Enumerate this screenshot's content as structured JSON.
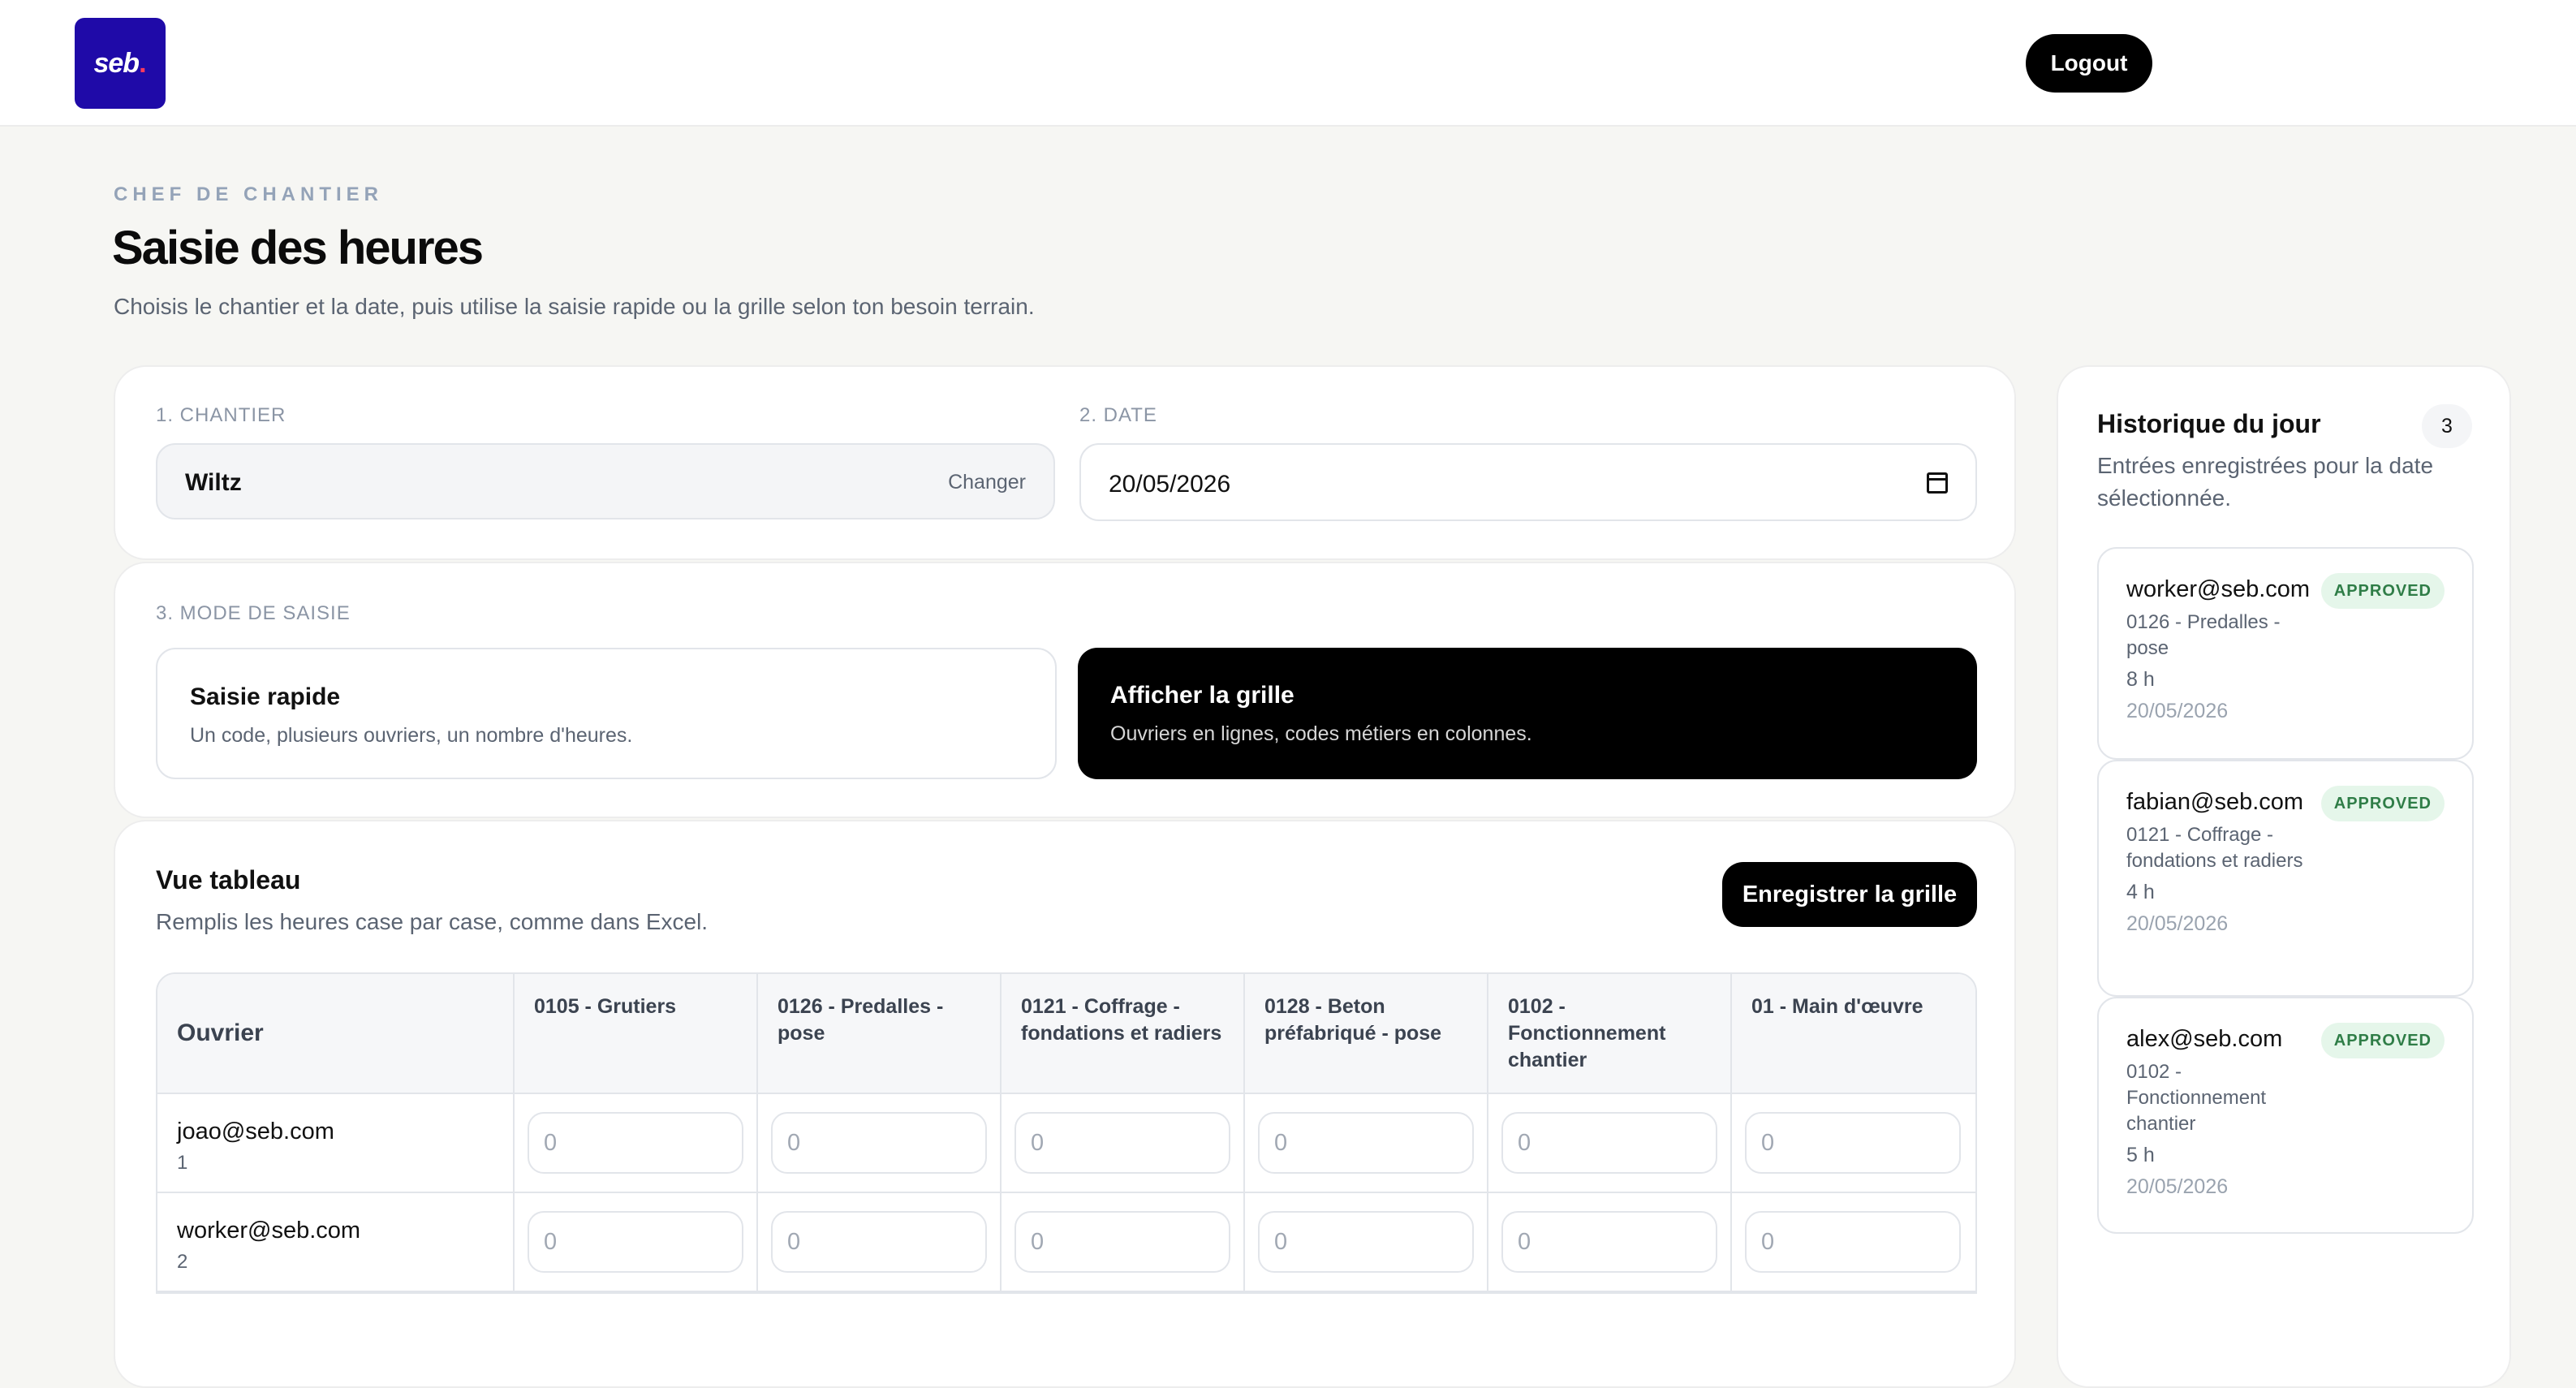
{
  "brand": {
    "logo_text": "seb",
    "logo_dot": "."
  },
  "header": {
    "logout_label": "Logout"
  },
  "page": {
    "eyebrow": "CHEF DE CHANTIER",
    "title": "Saisie des heures",
    "subtitle": "Choisis le chantier et la date, puis utilise la saisie rapide ou la grille selon ton besoin terrain."
  },
  "selection": {
    "chantier_label": "1. CHANTIER",
    "chantier_value": "Wiltz",
    "changer_label": "Changer",
    "date_label": "2. DATE",
    "date_value": "20/05/2026"
  },
  "mode": {
    "label": "3. MODE DE SAISIE",
    "quick": {
      "title": "Saisie rapide",
      "desc": "Un code, plusieurs ouvriers, un nombre d'heures."
    },
    "grid": {
      "title": "Afficher la grille",
      "desc": "Ouvriers en lignes, codes métiers en colonnes."
    }
  },
  "table": {
    "title": "Vue tableau",
    "subtitle": "Remplis les heures case par case, comme dans Excel.",
    "save_label": "Enregistrer la grille",
    "ouvrier_header": "Ouvrier",
    "columns": [
      "0105 - Grutiers",
      "0126 - Predalles - pose",
      "0121 - Coffrage - fondations et radiers",
      "0128 - Beton préfabriqué - pose",
      "0102 - Fonctionnement chantier",
      "01 - Main d'œuvre"
    ],
    "input_placeholder": "0",
    "rows": [
      {
        "email": "joao@seb.com",
        "num": "1"
      },
      {
        "email": "worker@seb.com",
        "num": "2"
      }
    ]
  },
  "history": {
    "title": "Historique du jour",
    "count": "3",
    "subtitle": "Entrées enregistrées pour la date sélectionnée.",
    "items": [
      {
        "email": "worker@seb.com",
        "code": "0126 - Predalles - pose",
        "hours": "8 h",
        "date": "20/05/2026",
        "status": "APPROVED"
      },
      {
        "email": "fabian@seb.com",
        "code": "0121 - Coffrage - fondations et radiers",
        "hours": "4 h",
        "date": "20/05/2026",
        "status": "APPROVED"
      },
      {
        "email": "alex@seb.com",
        "code": "0102 - Fonctionnement chantier",
        "hours": "5 h",
        "date": "20/05/2026",
        "status": "APPROVED"
      }
    ]
  }
}
